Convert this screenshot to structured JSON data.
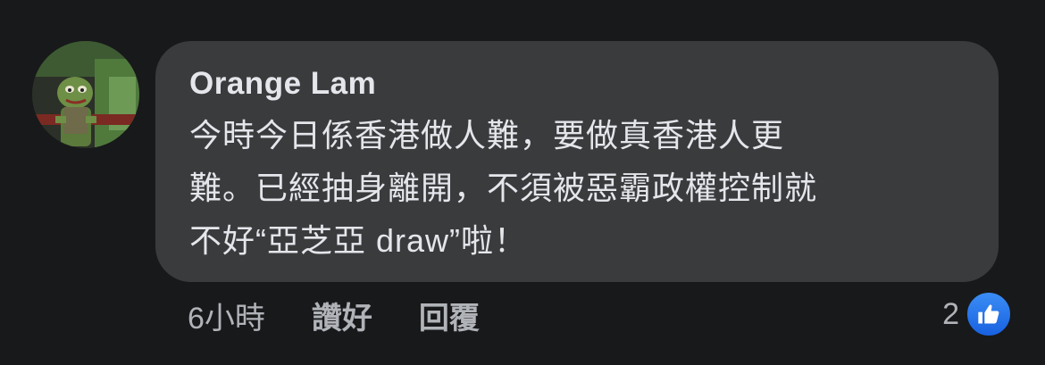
{
  "comment": {
    "author": "Orange Lam",
    "text": "今時今日係香港做人難，要做真香港人更\n難。已經抽身離開，不須被惡霸政權控制就\n不好“亞芝亞 draw”啦！",
    "time": "6小時",
    "like_label": "讚好",
    "reply_label": "回覆",
    "reaction_count": "2"
  },
  "icons": {
    "avatar": "avatar-image",
    "reaction": "like-thumbs-up-icon"
  },
  "colors": {
    "background": "#18191a",
    "bubble": "#3a3b3c",
    "primary_text": "#e4e6eb",
    "secondary_text": "#b0b3b8",
    "like_blue": "#1877f2"
  }
}
